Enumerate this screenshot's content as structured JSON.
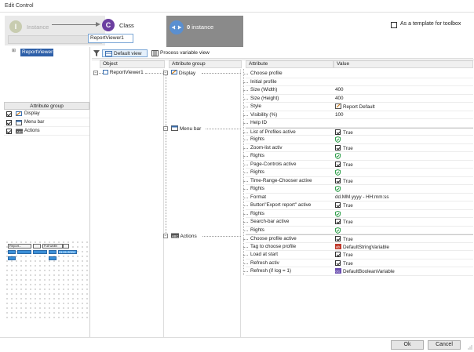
{
  "window": {
    "title": "Edit Control"
  },
  "wizard": {
    "step1": {
      "number": "I",
      "label": "Instance"
    },
    "step2": {
      "number": "C",
      "label": "Class",
      "input_value": "ReportViewer1"
    },
    "step3": {
      "number": "0",
      "label": "instance",
      "icon": "link-arrows-icon"
    }
  },
  "template_checkbox": {
    "label": "As a template for toolbox",
    "checked": false
  },
  "tree": {
    "selected_item": "ReportViewer1"
  },
  "attribute_group_panel": {
    "header": "Attribute group",
    "items": [
      {
        "label": "Display",
        "checked": true,
        "icon": "display-icon"
      },
      {
        "label": "Menu bar",
        "checked": true,
        "icon": "menubar-icon"
      },
      {
        "label": "Actions",
        "checked": true,
        "icon": "actions-icon"
      }
    ]
  },
  "preview": {
    "select1": "Report...",
    "select2": "Full width",
    "field": "01.01.2024"
  },
  "toolbar": {
    "default_view": "Default view",
    "process_view": "Process variable view"
  },
  "columns": {
    "object": "Object",
    "attribute_group": "Attribute group",
    "attribute": "Attribute",
    "value": "Value"
  },
  "object_tree": {
    "node": "ReportViewer1"
  },
  "groups": [
    {
      "label": "Display"
    },
    {
      "label": "Menu bar"
    },
    {
      "label": "Actions"
    }
  ],
  "rows": [
    {
      "attribute": "Choose profile",
      "value": "",
      "vtype": "text",
      "group_start": true
    },
    {
      "attribute": "Initial profile",
      "value": "",
      "vtype": "text"
    },
    {
      "attribute": "Size (Width)",
      "value": "400",
      "vtype": "text"
    },
    {
      "attribute": "Size (Height)",
      "value": "400",
      "vtype": "text"
    },
    {
      "attribute": "Style",
      "value": "Report Default",
      "vtype": "style"
    },
    {
      "attribute": "Visibility (%)",
      "value": "100",
      "vtype": "text"
    },
    {
      "attribute": "Help ID",
      "value": "",
      "vtype": "text"
    },
    {
      "attribute": "List of Profiles active",
      "value": "True",
      "vtype": "check",
      "group_start": true
    },
    {
      "attribute": "Rights",
      "value": "",
      "vtype": "shield"
    },
    {
      "attribute": "Zoom-list activ",
      "value": "True",
      "vtype": "check"
    },
    {
      "attribute": "Rights",
      "value": "",
      "vtype": "shield"
    },
    {
      "attribute": "Page-Controls active",
      "value": "True",
      "vtype": "check"
    },
    {
      "attribute": "Rights",
      "value": "",
      "vtype": "shield"
    },
    {
      "attribute": "Time-Range-Chooser active",
      "value": "True",
      "vtype": "check"
    },
    {
      "attribute": "Rights",
      "value": "",
      "vtype": "shield"
    },
    {
      "attribute": "Format",
      "value": "dd.MM.yyyy - HH:mm:ss",
      "vtype": "text"
    },
    {
      "attribute": "Button\"Export report\" active",
      "value": "True",
      "vtype": "check"
    },
    {
      "attribute": "Rights",
      "value": "",
      "vtype": "shield"
    },
    {
      "attribute": "Search-bar active",
      "value": "True",
      "vtype": "check"
    },
    {
      "attribute": "Rights",
      "value": "",
      "vtype": "shield"
    },
    {
      "attribute": "Choose profile active",
      "value": "True",
      "vtype": "check",
      "group_start": true
    },
    {
      "attribute": "Tag to choose profile",
      "value": "DefaultStringVariable",
      "vtype": "strvar"
    },
    {
      "attribute": "Load at start",
      "value": "True",
      "vtype": "check"
    },
    {
      "attribute": "Refresh activ",
      "value": "True",
      "vtype": "check"
    },
    {
      "attribute": "Refresh (if log = 1)",
      "value": "DefaultBooleanVariable",
      "vtype": "boolvar"
    }
  ],
  "buttons": {
    "ok": "Ok",
    "cancel": "Cancel"
  },
  "colors": {
    "accent": "#2d5fa8",
    "class_step": "#6b3fa0",
    "instance_step": "#8a8a8a",
    "shield": "#2e9e4a"
  }
}
